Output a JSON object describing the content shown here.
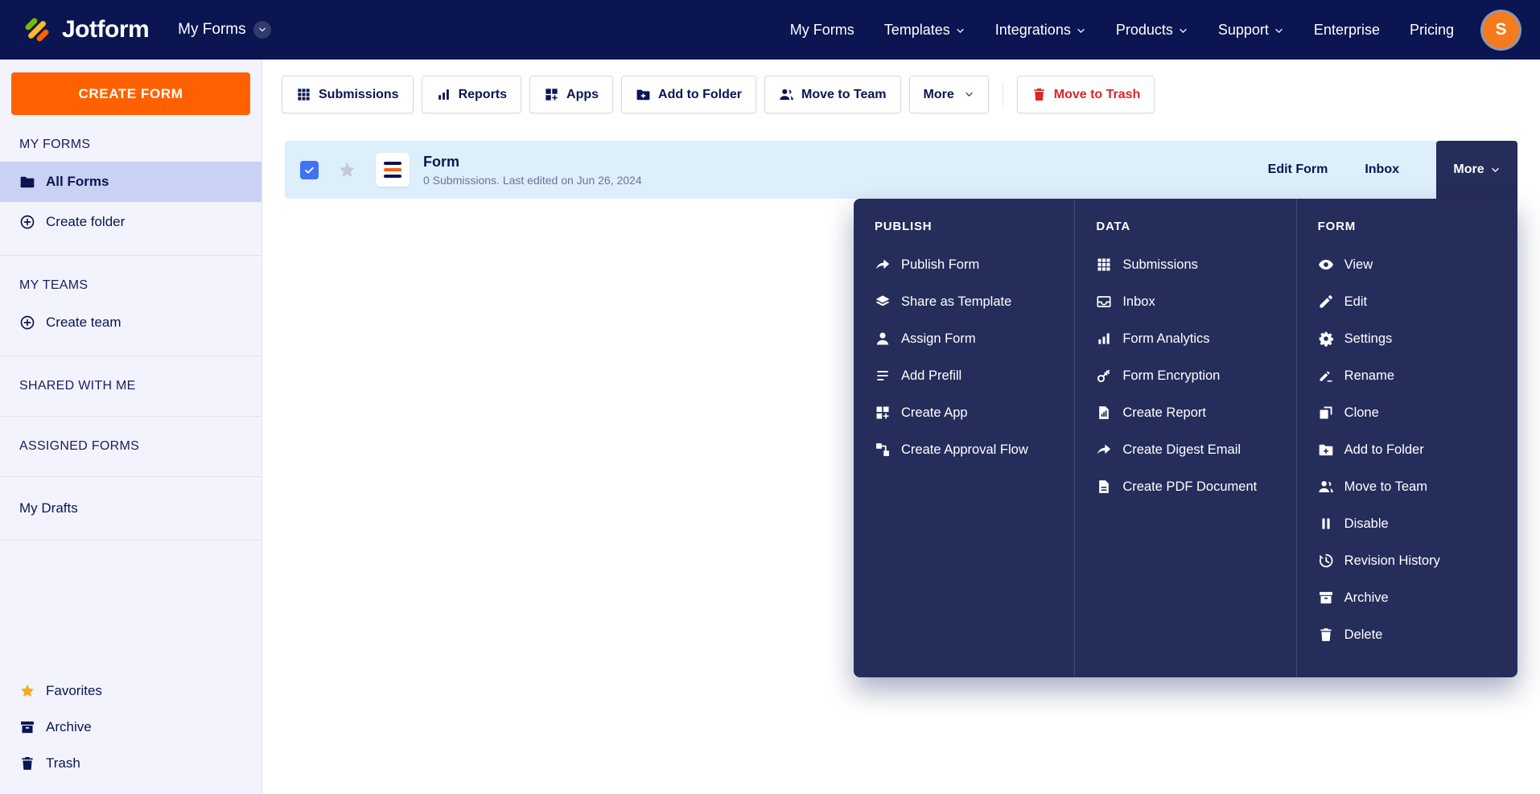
{
  "navbar": {
    "logo_text": "Jotform",
    "workspace_label": "My Forms",
    "links": [
      {
        "label": "My Forms"
      },
      {
        "label": "Templates"
      },
      {
        "label": "Integrations"
      },
      {
        "label": "Products"
      },
      {
        "label": "Support"
      },
      {
        "label": "Enterprise"
      },
      {
        "label": "Pricing"
      }
    ],
    "avatar_initial": "S"
  },
  "sidebar": {
    "create_form_label": "CREATE FORM",
    "my_forms_title": "MY FORMS",
    "all_forms_label": "All Forms",
    "create_folder_label": "Create folder",
    "my_teams_title": "MY TEAMS",
    "create_team_label": "Create team",
    "shared_title": "SHARED WITH ME",
    "assigned_title": "ASSIGNED FORMS",
    "drafts_label": "My Drafts",
    "footer": [
      {
        "label": "Favorites"
      },
      {
        "label": "Archive"
      },
      {
        "label": "Trash"
      }
    ]
  },
  "toolbar": {
    "submissions": "Submissions",
    "reports": "Reports",
    "apps": "Apps",
    "add_to_folder": "Add to Folder",
    "move_to_team": "Move to Team",
    "more": "More",
    "move_to_trash": "Move to Trash"
  },
  "form_row": {
    "title": "Form",
    "meta": "0 Submissions. Last edited on Jun 26, 2024",
    "edit_form": "Edit Form",
    "inbox": "Inbox",
    "more": "More"
  },
  "menu": {
    "publish": {
      "title": "PUBLISH",
      "items": [
        "Publish Form",
        "Share as Template",
        "Assign Form",
        "Add Prefill",
        "Create App",
        "Create Approval Flow"
      ]
    },
    "data": {
      "title": "DATA",
      "items": [
        "Submissions",
        "Inbox",
        "Form Analytics",
        "Form Encryption",
        "Create Report",
        "Create Digest Email",
        "Create PDF Document"
      ]
    },
    "form": {
      "title": "FORM",
      "items": [
        "View",
        "Edit",
        "Settings",
        "Rename",
        "Clone",
        "Add to Folder",
        "Move to Team",
        "Disable",
        "Revision History",
        "Archive",
        "Delete"
      ]
    }
  },
  "colors": {
    "navbar_bg": "#0A1551",
    "accent_orange": "#FF6100",
    "menu_bg": "#252D5B",
    "sidebar_bg": "#F3F3FE",
    "selected_item_bg": "#C9D1F5",
    "row_selected_bg": "#DEEFFC",
    "checkbox_blue": "#4171F5",
    "danger_red": "#DC2626",
    "favorite_star": "#F9A826"
  }
}
